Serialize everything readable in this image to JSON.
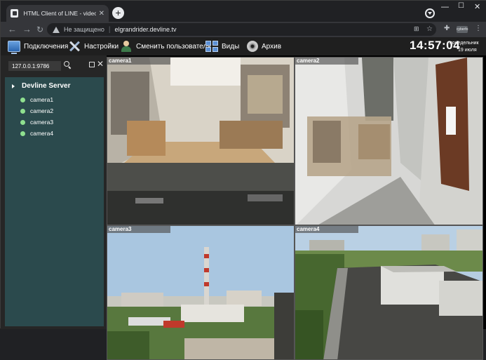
{
  "browser": {
    "tab_title": "HTML Client of LINE - video surveillance",
    "new_tab_symbol": "+",
    "address_insecure": "Не защищено",
    "address_url": "elgrandrider.devline.tv",
    "extension_badge": "cyberfo"
  },
  "menu": {
    "connections": "Подключения",
    "settings": "Настройки",
    "change_user": "Сменить пользователя",
    "views": "Виды",
    "archive": "Архив"
  },
  "clock": {
    "time": "14:57:04",
    "weekday": "понедельник",
    "date": "19 июля"
  },
  "sidebar": {
    "server_address": "127.0.0.1:9786",
    "server_name": "Devline Server",
    "cameras": [
      "camera1",
      "camera2",
      "camera3",
      "camera4"
    ]
  },
  "cameras": [
    {
      "label": "camera1"
    },
    {
      "label": "camera2"
    },
    {
      "label": "camera3"
    },
    {
      "label": "camera4"
    }
  ],
  "colors": {
    "tree_bg": "#2b4a4d",
    "online_dot": "#8fe08f",
    "menubar_bg": "#1f1f1f"
  }
}
